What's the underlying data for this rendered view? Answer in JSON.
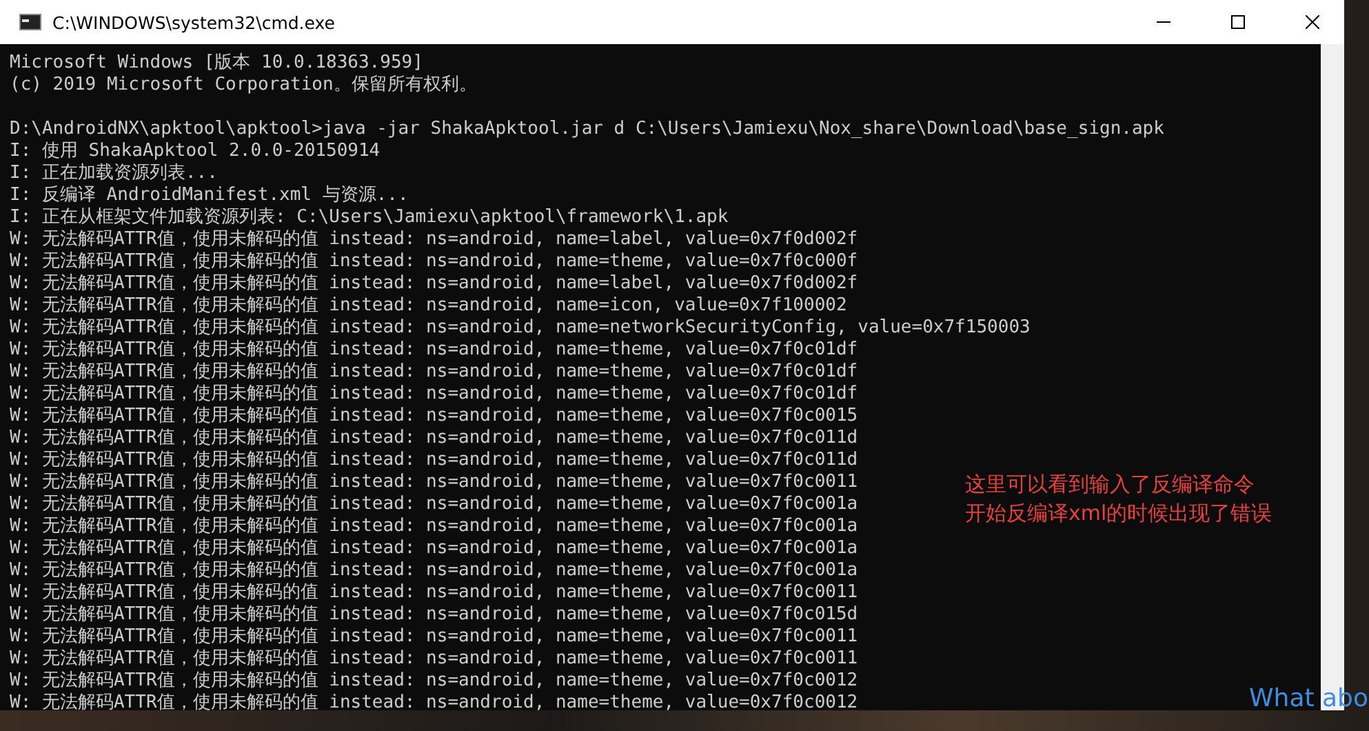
{
  "window": {
    "title": "C:\\WINDOWS\\system32\\cmd.exe"
  },
  "console": {
    "blocks": [
      [
        "Microsoft Windows [版本 10.0.18363.959]",
        "(c) 2019 Microsoft Corporation。保留所有权利。"
      ],
      [
        "D:\\AndroidNX\\apktool\\apktool>java -jar ShakaApktool.jar d C:\\Users\\Jamiexu\\Nox_share\\Download\\base_sign.apk",
        "I: 使用 ShakaApktool 2.0.0-20150914",
        "I: 正在加载资源列表...",
        "I: 反编译 AndroidManifest.xml 与资源...",
        "I: 正在从框架文件加载资源列表: C:\\Users\\Jamiexu\\apktool\\framework\\1.apk",
        "W: 无法解码ATTR值，使用未解码的值 instead: ns=android, name=label, value=0x7f0d002f",
        "W: 无法解码ATTR值，使用未解码的值 instead: ns=android, name=theme, value=0x7f0c000f",
        "W: 无法解码ATTR值，使用未解码的值 instead: ns=android, name=label, value=0x7f0d002f",
        "W: 无法解码ATTR值，使用未解码的值 instead: ns=android, name=icon, value=0x7f100002",
        "W: 无法解码ATTR值，使用未解码的值 instead: ns=android, name=networkSecurityConfig, value=0x7f150003",
        "W: 无法解码ATTR值，使用未解码的值 instead: ns=android, name=theme, value=0x7f0c01df",
        "W: 无法解码ATTR值，使用未解码的值 instead: ns=android, name=theme, value=0x7f0c01df",
        "W: 无法解码ATTR值，使用未解码的值 instead: ns=android, name=theme, value=0x7f0c01df",
        "W: 无法解码ATTR值，使用未解码的值 instead: ns=android, name=theme, value=0x7f0c0015",
        "W: 无法解码ATTR值，使用未解码的值 instead: ns=android, name=theme, value=0x7f0c011d",
        "W: 无法解码ATTR值，使用未解码的值 instead: ns=android, name=theme, value=0x7f0c011d",
        "W: 无法解码ATTR值，使用未解码的值 instead: ns=android, name=theme, value=0x7f0c0011",
        "W: 无法解码ATTR值，使用未解码的值 instead: ns=android, name=theme, value=0x7f0c001a",
        "W: 无法解码ATTR值，使用未解码的值 instead: ns=android, name=theme, value=0x7f0c001a",
        "W: 无法解码ATTR值，使用未解码的值 instead: ns=android, name=theme, value=0x7f0c001a",
        "W: 无法解码ATTR值，使用未解码的值 instead: ns=android, name=theme, value=0x7f0c001a",
        "W: 无法解码ATTR值，使用未解码的值 instead: ns=android, name=theme, value=0x7f0c0011",
        "W: 无法解码ATTR值，使用未解码的值 instead: ns=android, name=theme, value=0x7f0c015d",
        "W: 无法解码ATTR值，使用未解码的值 instead: ns=android, name=theme, value=0x7f0c0011",
        "W: 无法解码ATTR值，使用未解码的值 instead: ns=android, name=theme, value=0x7f0c0011",
        "W: 无法解码ATTR值，使用未解码的值 instead: ns=android, name=theme, value=0x7f0c0012",
        "W: 无法解码ATTR值，使用未解码的值 instead: ns=android, name=theme, value=0x7f0c0012"
      ]
    ]
  },
  "annotation": {
    "lines": [
      "这里可以看到输入了反编译命令",
      "开始反编译xml的时候出现了错误"
    ]
  },
  "desktop_text": "What abo"
}
